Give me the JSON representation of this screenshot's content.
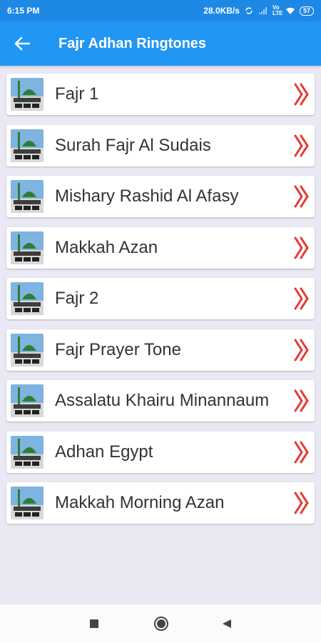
{
  "status_bar": {
    "time": "6:15 PM",
    "speed": "28.0KB/s",
    "network": "Vo LTE",
    "battery": "57"
  },
  "app_bar": {
    "title": "Fajr Adhan Ringtones",
    "back_icon": "arrow-left-icon"
  },
  "colors": {
    "app_bar": "#2196f3",
    "status_bar": "#1e88e5",
    "background": "#e9e8f3",
    "chevron": "#e53935"
  },
  "ringtones": [
    {
      "label": "Fajr 1"
    },
    {
      "label": "Surah Fajr Al Sudais"
    },
    {
      "label": "Mishary Rashid Al Afasy"
    },
    {
      "label": "Makkah Azan"
    },
    {
      "label": "Fajr 2"
    },
    {
      "label": "Fajr Prayer Tone"
    },
    {
      "label": "Assalatu Khairu Minannaum"
    },
    {
      "label": "Adhan Egypt"
    },
    {
      "label": "Makkah Morning Azan"
    }
  ],
  "nav_bar": {
    "recents_icon": "square-icon",
    "home_icon": "circle-icon",
    "back_icon": "triangle-back-icon"
  }
}
